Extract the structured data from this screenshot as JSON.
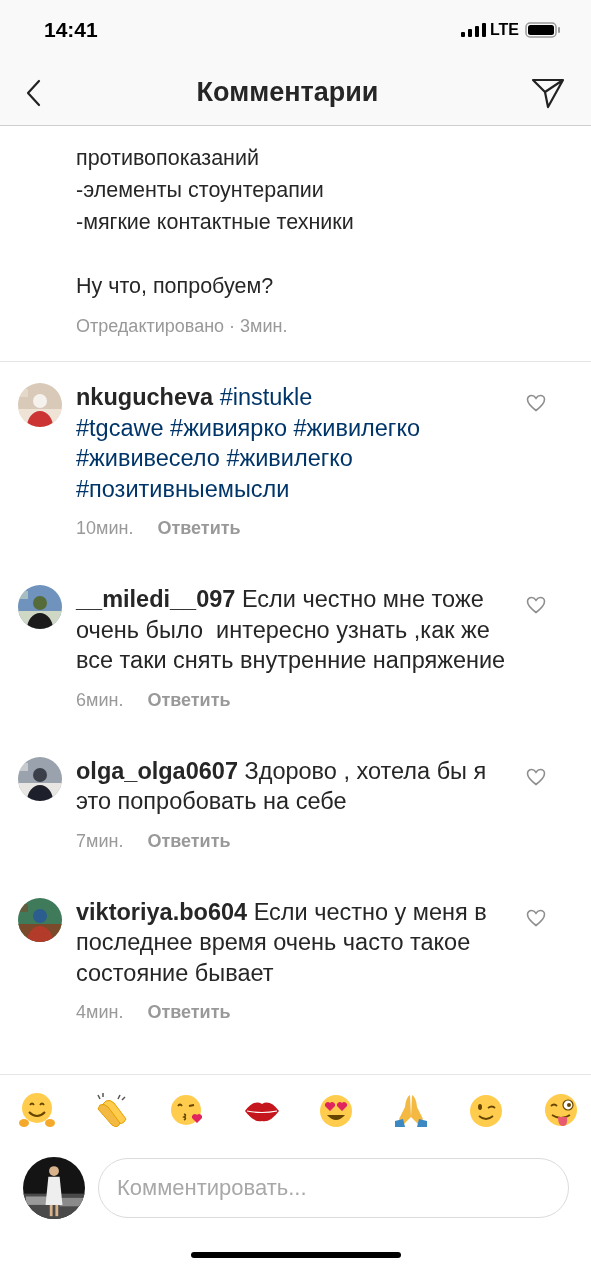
{
  "status_bar": {
    "time": "14:41",
    "network": "LTE"
  },
  "header": {
    "title": "Комментарии"
  },
  "caption": {
    "lines": [
      "противопоказаний",
      "-элементы стоунтерапии",
      "-мягкие контактные техники"
    ],
    "question": "Ну что, попробуем?",
    "meta": "Отредактировано · 3мин."
  },
  "comments": [
    {
      "username": "nkugucheva",
      "segments": [
        {
          "kind": "hashtag",
          "text": "#instukle"
        },
        {
          "kind": "hashtag",
          "text": "#tgcawe",
          "line_break": true
        },
        {
          "kind": "hashtag",
          "text": "#живиярко"
        },
        {
          "kind": "hashtag",
          "text": "#живилегко"
        },
        {
          "kind": "hashtag",
          "text": "#жививесело"
        },
        {
          "kind": "hashtag",
          "text": "#живилегко"
        },
        {
          "kind": "hashtag",
          "text": "#позитивныемысли"
        }
      ],
      "time": "10мин.",
      "reply": "Ответить",
      "liked": false
    },
    {
      "username": "__miledi__097",
      "segments": [
        {
          "kind": "text",
          "text": "Если честно мне тоже очень было  интересно узнать ,как же все таки снять внутренние напряжение"
        }
      ],
      "time": "6мин.",
      "reply": "Ответить",
      "liked": false
    },
    {
      "username": "olga_olga0607",
      "segments": [
        {
          "kind": "text",
          "text": "Здорово , хотела бы я это попробовать на себе"
        }
      ],
      "time": "7мин.",
      "reply": "Ответить",
      "liked": false
    },
    {
      "username": "viktoriya.bo604",
      "segments": [
        {
          "kind": "text",
          "text": "Если честно у меня в последнее время очень часто такое состояние бывает"
        }
      ],
      "time": "4мин.",
      "reply": "Ответить",
      "liked": false
    }
  ],
  "composer": {
    "placeholder": "Комментировать..."
  }
}
